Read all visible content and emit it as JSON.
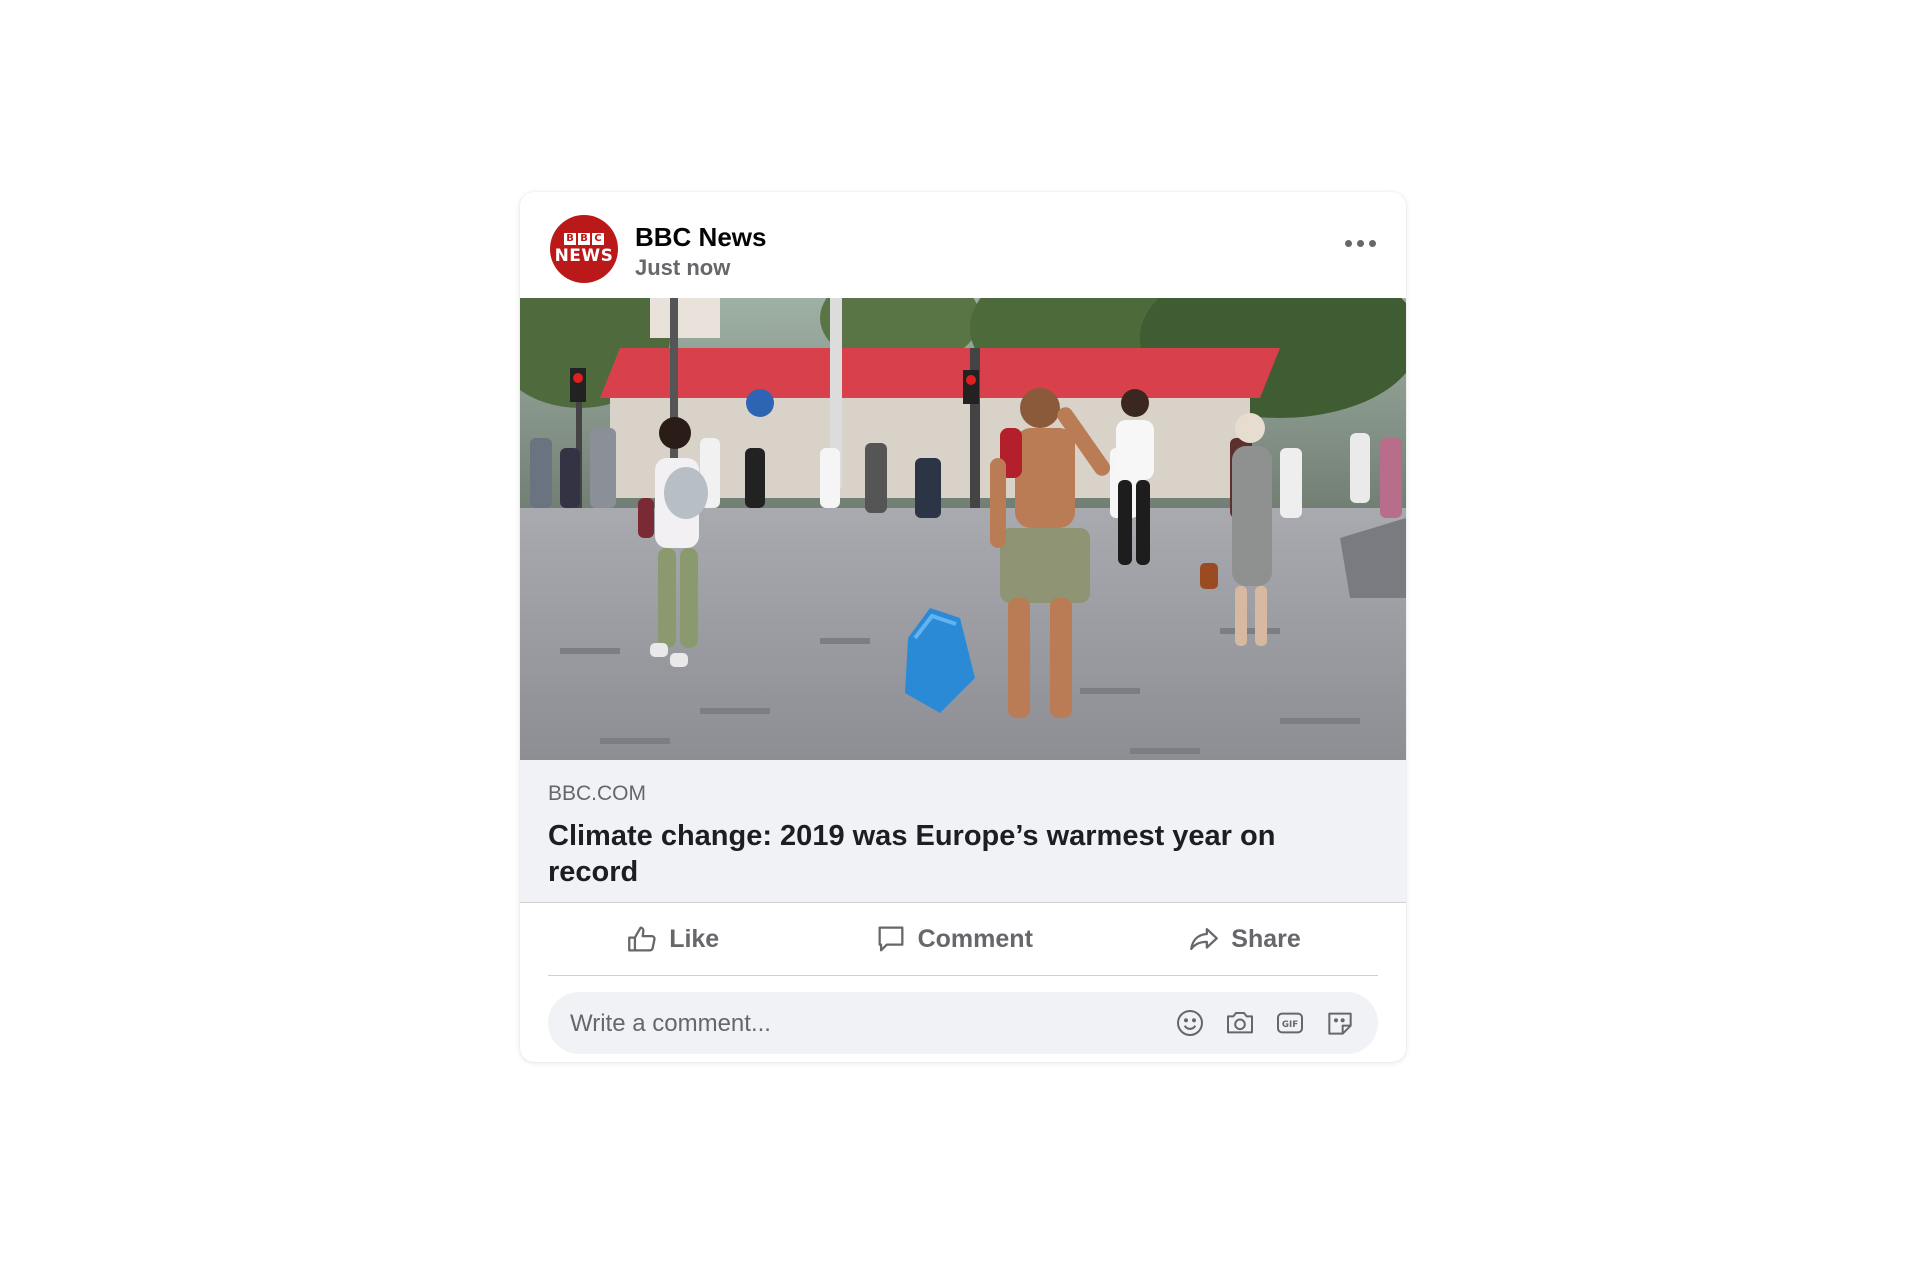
{
  "post": {
    "page_name": "BBC News",
    "timestamp": "Just now",
    "avatar": {
      "logo_top": "BBC",
      "logo_bottom": "NEWS",
      "brand_color": "#bb1919"
    },
    "more_icon": "more-horizontal-icon"
  },
  "link_preview": {
    "domain": "BBC.COM",
    "title": "Climate change: 2019 was Europe’s warmest year on record"
  },
  "actions": {
    "like_label": "Like",
    "comment_label": "Comment",
    "share_label": "Share",
    "like_icon": "thumbs-up-icon",
    "comment_icon": "speech-bubble-icon",
    "share_icon": "share-arrow-icon"
  },
  "comment_box": {
    "placeholder": "Write a comment...",
    "tools": [
      "emoji-icon",
      "camera-icon",
      "gif-icon",
      "sticker-icon"
    ]
  },
  "colors": {
    "secondary_text": "#65676b",
    "primary_text": "#050505",
    "preview_bg": "#f0f2f5",
    "divider": "#ced0d4"
  }
}
